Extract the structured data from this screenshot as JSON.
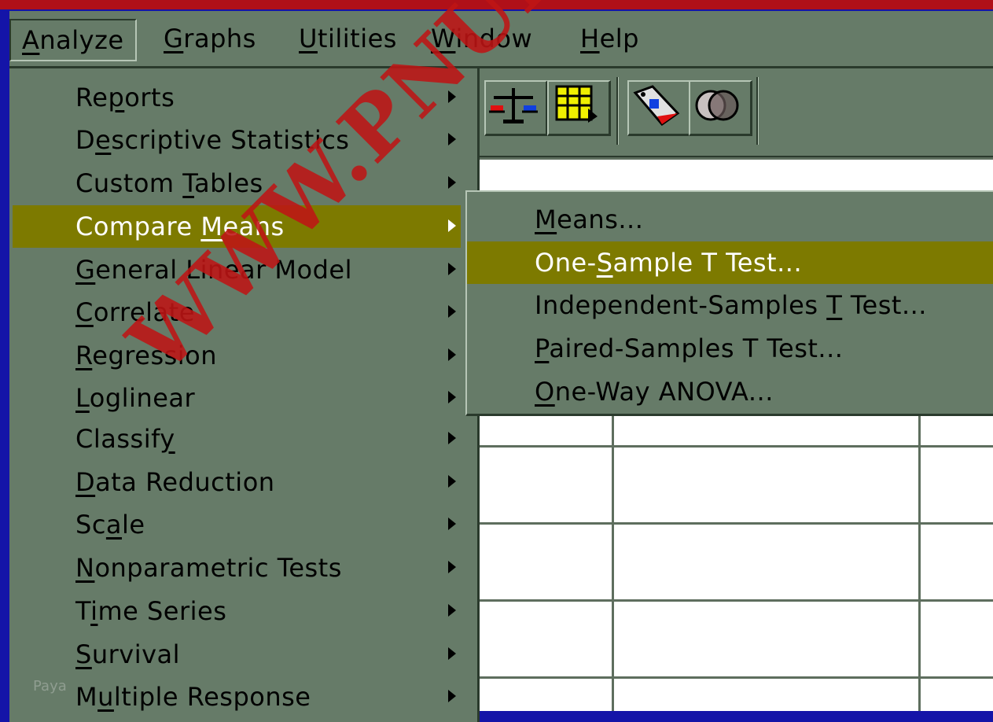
{
  "menubar": {
    "items": [
      {
        "label": "Analyze",
        "underline": "A"
      },
      {
        "label": "Graphs",
        "underline": "G"
      },
      {
        "label": "Utilities",
        "underline": "U"
      },
      {
        "label": "Window",
        "underline": "W"
      },
      {
        "label": "Help",
        "underline": "H"
      }
    ]
  },
  "analyze_menu": {
    "items": [
      {
        "pre": "Re",
        "u": "p",
        "post": "orts"
      },
      {
        "pre": "D",
        "u": "e",
        "post": "scriptive Statistics"
      },
      {
        "pre": "Custom ",
        "u": "T",
        "post": "ables"
      },
      {
        "pre": "Compare ",
        "u": "M",
        "post": "eans"
      },
      {
        "pre": "",
        "u": "G",
        "post": "eneral Linear Model"
      },
      {
        "pre": "",
        "u": "C",
        "post": "orrelate"
      },
      {
        "pre": "",
        "u": "R",
        "post": "egression"
      },
      {
        "pre": "",
        "u": "L",
        "post": "oglinear"
      },
      {
        "pre": "Classif",
        "u": "y",
        "post": ""
      },
      {
        "pre": "",
        "u": "D",
        "post": "ata Reduction"
      },
      {
        "pre": "Sc",
        "u": "a",
        "post": "le"
      },
      {
        "pre": "",
        "u": "N",
        "post": "onparametric Tests"
      },
      {
        "pre": "T",
        "u": "i",
        "post": "me Series"
      },
      {
        "pre": "",
        "u": "S",
        "post": "urvival"
      },
      {
        "pre": "M",
        "u": "u",
        "post": "ltiple Response"
      }
    ]
  },
  "compare_means_submenu": {
    "items": [
      {
        "pre": "",
        "u": "M",
        "post": "eans..."
      },
      {
        "pre": "One-",
        "u": "S",
        "post": "ample T Test..."
      },
      {
        "pre": "Independent-Samples ",
        "u": "T",
        "post": " Test..."
      },
      {
        "pre": "",
        "u": "P",
        "post": "aired-Samples T Test..."
      },
      {
        "pre": "",
        "u": "O",
        "post": "ne-Way ANOVA..."
      }
    ]
  },
  "toolbar": {
    "icons": [
      "scale-icon",
      "table-icon",
      "value-labels-icon",
      "use-sets-icon"
    ]
  },
  "watermark": "WWW.PNUEB.COM",
  "faint_text": "Paya",
  "colors": {
    "frame_blue": "#1414a8",
    "top_stripe": "#b01018",
    "face": "#667b68",
    "highlight": "#7d7a00",
    "watermark": "#be1414"
  }
}
